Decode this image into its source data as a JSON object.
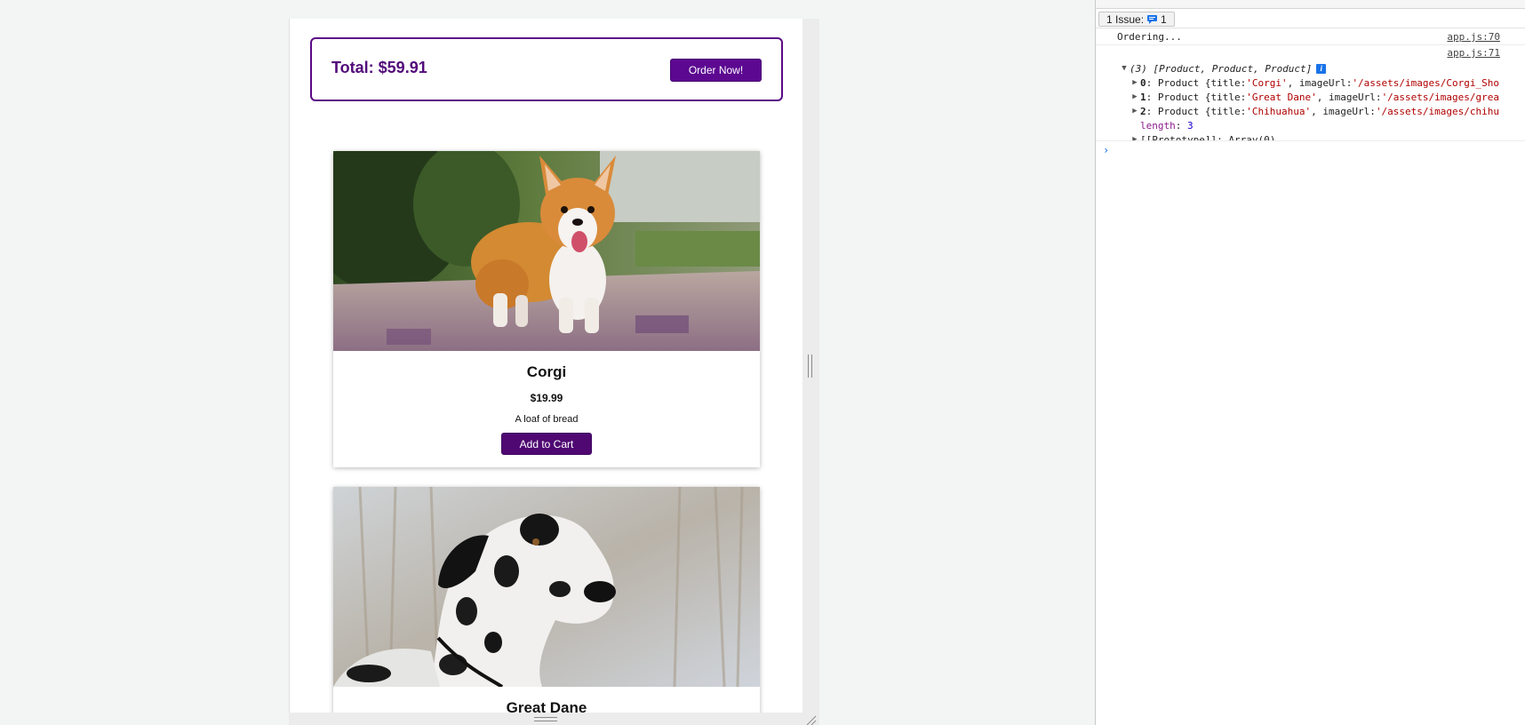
{
  "cart": {
    "total_text": "Total: $59.91",
    "order_button": "Order Now!"
  },
  "products": [
    {
      "title": "Corgi",
      "price": "$19.99",
      "description": "A loaf of bread",
      "button": "Add to Cart"
    },
    {
      "title": "Great Dane"
    }
  ],
  "devtools": {
    "issues_label": "1 Issue:",
    "issues_count": "1",
    "log1_text": "Ordering...",
    "log1_source": "app.js:70",
    "log2_source": "app.js:71",
    "array_header": "(3) [Product, Product, Product]",
    "entries": [
      {
        "index": "0",
        "prefix": "Product {title: ",
        "title": "'Corgi'",
        "mid": ", imageUrl: ",
        "url": "'/assets/images/Corgi_Sho"
      },
      {
        "index": "1",
        "prefix": "Product {title: ",
        "title": "'Great Dane'",
        "mid": ", imageUrl: ",
        "url": "'/assets/images/grea"
      },
      {
        "index": "2",
        "prefix": "Product {title: ",
        "title": "'Chihuahua'",
        "mid": ", imageUrl: ",
        "url": "'/assets/images/chihu"
      }
    ],
    "length_key": "length",
    "length_value": "3",
    "prototype_key": "[[Prototype]]",
    "prototype_value": ": Array(0)",
    "prompt_symbol": "›"
  },
  "colors": {
    "brand_purple": "#5c0891",
    "cart_border": "#5b0a85",
    "console_string": "#b00000",
    "console_number": "#1c00cf",
    "info_blue": "#1a73e8"
  },
  "icons": [
    "issue-chat-icon",
    "info-icon",
    "expand-triangle-icon",
    "collapse-triangle-icon",
    "console-prompt-icon",
    "resize-handle-icon"
  ]
}
